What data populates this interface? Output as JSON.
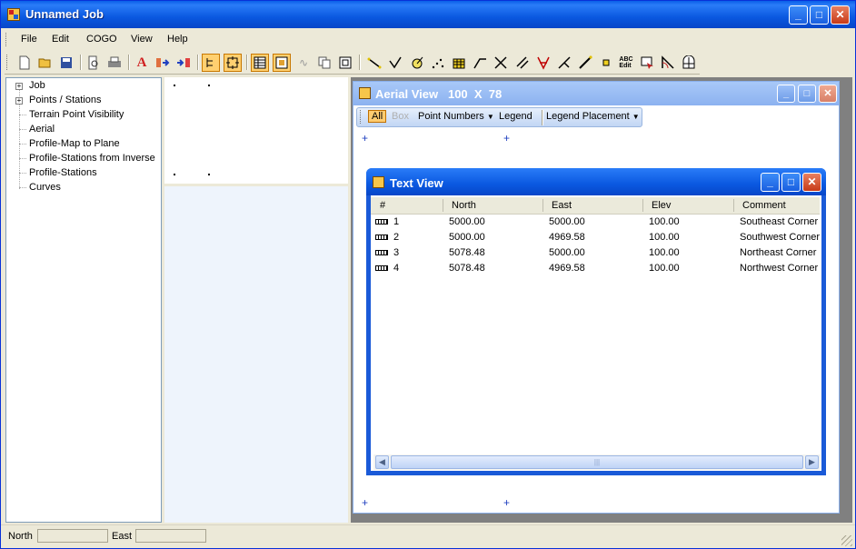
{
  "window": {
    "title": "Unnamed Job"
  },
  "menu": [
    "File",
    "Edit",
    "COGO",
    "View",
    "Help"
  ],
  "tree": {
    "items": [
      {
        "label": "Job",
        "expandable": true
      },
      {
        "label": "Points / Stations",
        "expandable": true
      },
      {
        "label": "Terrain Point Visibility",
        "expandable": false
      },
      {
        "label": "Aerial",
        "expandable": false
      },
      {
        "label": "Profile-Map to Plane",
        "expandable": false
      },
      {
        "label": "Profile-Stations from Inverse",
        "expandable": false
      },
      {
        "label": "Profile-Stations",
        "expandable": false
      },
      {
        "label": "Curves",
        "expandable": false
      }
    ]
  },
  "aerial_view": {
    "title": "Aerial View   100  X  78",
    "toolbar": {
      "all": "All",
      "box": "Box",
      "point_numbers": "Point Numbers",
      "legend": "Legend",
      "legend_placement": "Legend Placement"
    }
  },
  "text_view": {
    "title": "Text View",
    "columns": [
      "#",
      "North",
      "East",
      "Elev",
      "Comment"
    ],
    "rows": [
      {
        "num": "1",
        "north": "5000.00",
        "east": "5000.00",
        "elev": "100.00",
        "comment": "Southeast Corner"
      },
      {
        "num": "2",
        "north": "5000.00",
        "east": "4969.58",
        "elev": "100.00",
        "comment": "Southwest Corner"
      },
      {
        "num": "3",
        "north": "5078.48",
        "east": "5000.00",
        "elev": "100.00",
        "comment": "Northeast Corner"
      },
      {
        "num": "4",
        "north": "5078.48",
        "east": "4969.58",
        "elev": "100.00",
        "comment": "Northwest Corner"
      }
    ]
  },
  "statusbar": {
    "north_label": "North",
    "east_label": "East",
    "north_value": "",
    "east_value": ""
  },
  "caption_glyphs": {
    "minimize": "_",
    "maximize": "□",
    "close": "✕"
  },
  "toolbar_icons": [
    "new-icon",
    "open-icon",
    "save-icon",
    "print-preview-icon",
    "print-icon",
    "font-icon",
    "import-icon",
    "export-icon",
    "tree-view-icon",
    "zoom-extents-icon",
    "table-view-icon",
    "plan-view-icon",
    "curve-icon",
    "copy-icon",
    "window-icon",
    "line-icon",
    "angle-icon",
    "circle-icon",
    "points-icon",
    "grid-icon",
    "traverse-icon",
    "intersect-icon",
    "offset-icon",
    "bearing-icon",
    "perpendicular-icon",
    "measure-icon",
    "point-icon",
    "text-edit-icon",
    "select-icon",
    "arc-icon",
    "area-icon"
  ]
}
